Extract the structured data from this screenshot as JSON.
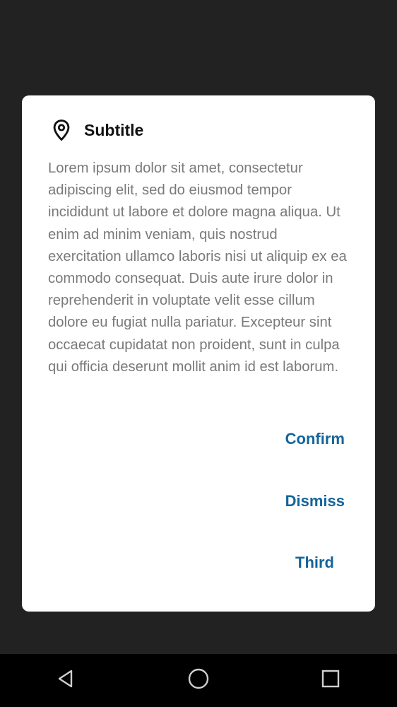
{
  "dialog": {
    "title": "Subtitle",
    "icon": "location-pin-icon",
    "body": "Lorem ipsum dolor sit amet, consectetur adipiscing elit, sed do eiusmod tempor incididunt ut labore et dolore magna aliqua. Ut enim ad minim veniam, quis nostrud exercitation ullamco laboris nisi ut aliquip ex ea commodo consequat. Duis aute irure dolor in reprehenderit in voluptate velit esse cillum dolore eu fugiat nulla pariatur. Excepteur sint occaecat cupidatat non proident, sunt in culpa qui officia deserunt mollit anim id est laborum.",
    "buttons": {
      "confirm": "Confirm",
      "dismiss": "Dismiss",
      "third": "Third"
    }
  },
  "navbar": {
    "back_icon": "back-triangle-icon",
    "home_icon": "home-circle-icon",
    "recents_icon": "recents-square-icon"
  },
  "colors": {
    "background": "#222222",
    "dialog": "#ffffff",
    "accent": "#14649a",
    "body_text": "#7a7a7a",
    "navbar": "#000000"
  }
}
